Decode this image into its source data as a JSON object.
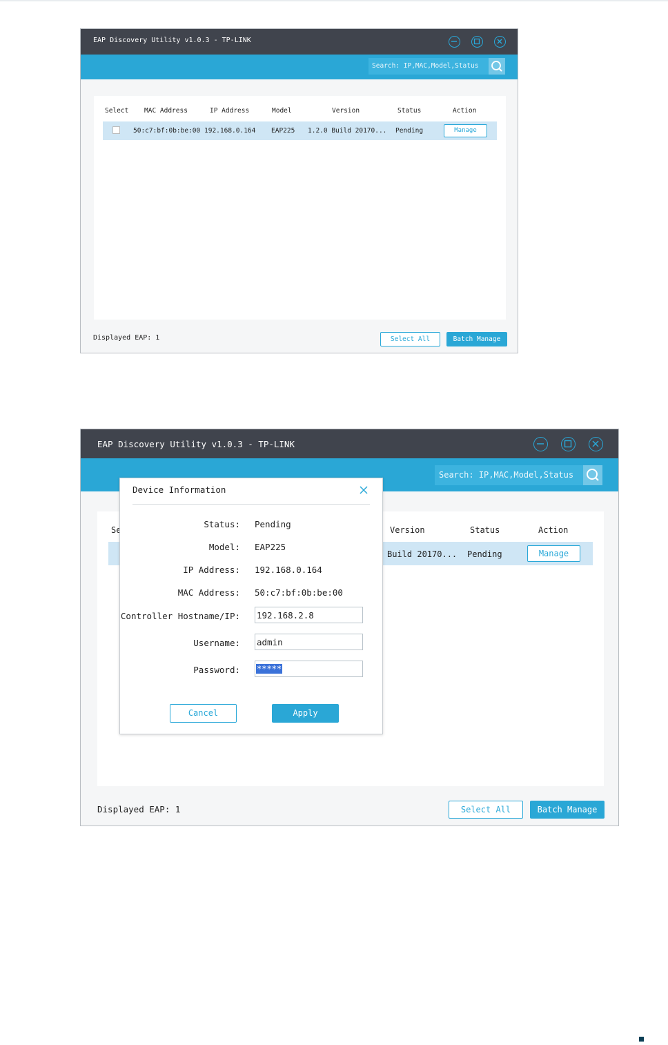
{
  "title": "EAP Discovery Utility v1.0.3 - TP-LINK",
  "search_placeholder": "Search: IP,MAC,Model,Status",
  "columns": {
    "select": "Select",
    "mac": "MAC Address",
    "ip": "IP Address",
    "model": "Model",
    "version": "Version",
    "status": "Status",
    "action": "Action"
  },
  "columns_partial_select": "Se",
  "row": {
    "mac": "50:c7:bf:0b:be:00",
    "ip": "192.168.0.164",
    "model": "EAP225",
    "version": "1.2.0 Build 20170...",
    "version_short": "Build 20170...",
    "status": "Pending",
    "action_label": "Manage"
  },
  "footer": {
    "displayed": "Displayed EAP: 1",
    "select_all": "Select All",
    "batch_manage": "Batch Manage"
  },
  "dialog": {
    "title": "Device Information",
    "status_label": "Status:",
    "status_value": "Pending",
    "model_label": "Model:",
    "model_value": "EAP225",
    "ip_label": "IP Address:",
    "ip_value": "192.168.0.164",
    "mac_label": "MAC Address:",
    "mac_value": "50:c7:bf:0b:be:00",
    "controller_label": "Controller Hostname/IP:",
    "controller_value": "192.168.2.8",
    "username_label": "Username:",
    "username_value": "admin",
    "password_label": "Password:",
    "password_value": "*****",
    "cancel": "Cancel",
    "apply": "Apply"
  },
  "colors": {
    "accent": "#2aa7d6",
    "titlebar": "#40444d",
    "row_highlight": "#cfe6f5"
  }
}
